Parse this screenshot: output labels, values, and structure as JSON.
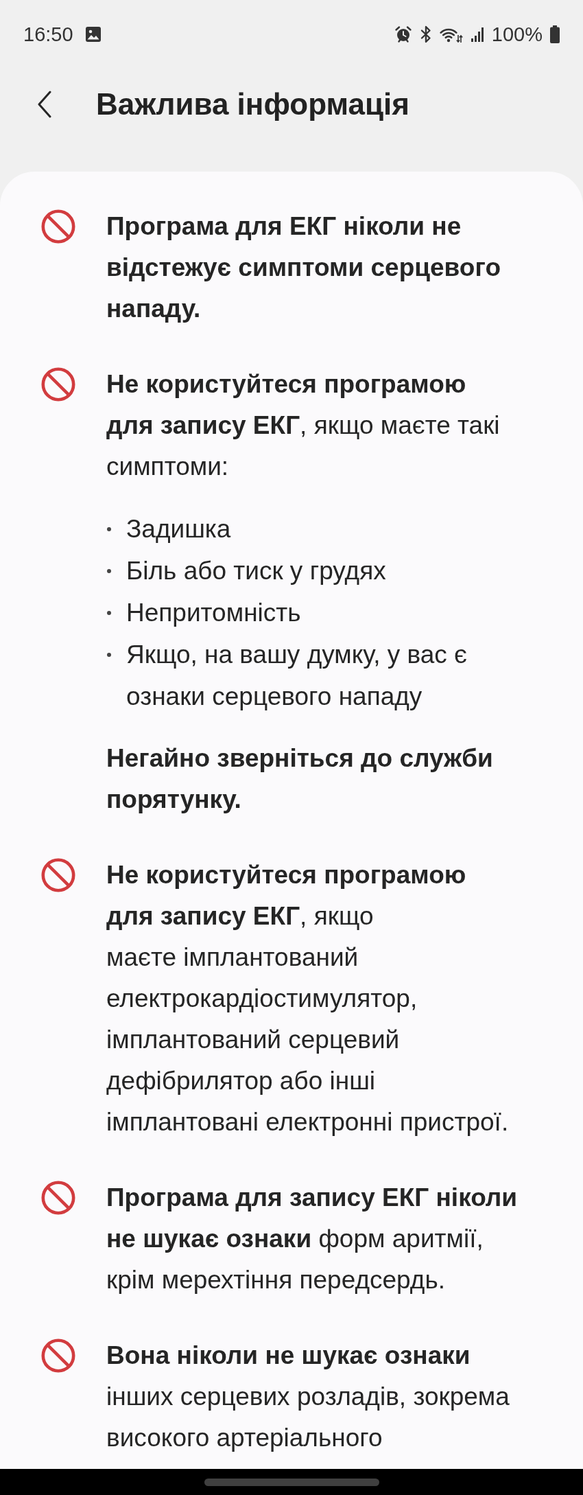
{
  "status_bar": {
    "time": "16:50",
    "battery": "100%"
  },
  "header": {
    "title": "Важлива інформація"
  },
  "warnings": [
    {
      "blocks": [
        {
          "kind": "bold_paragraph",
          "text": "Програма для ЕКГ ніколи не відстежує симптоми серцевого нападу."
        }
      ]
    },
    {
      "blocks": [
        {
          "kind": "paragraph",
          "text": "**Не користуйтеся програмою для запису ЕКГ**, якщо маєте такі симптоми:"
        },
        {
          "kind": "bullets",
          "items": [
            "Задишка",
            "Біль або тиск у грудях",
            "Непритомність",
            "Якщо, на вашу думку, у вас є ознаки серцевого нападу"
          ]
        },
        {
          "kind": "bold_paragraph",
          "text": "Негайно зверніться до служби порятунку."
        }
      ]
    },
    {
      "blocks": [
        {
          "kind": "paragraph",
          "text": "**Не користуйтеся програмою для запису ЕКГ**, якщо маєте імплантований електрокардіостимулятор, імплантований серцевий дефібрилятор або інші імплантовані електронні пристрої."
        }
      ]
    },
    {
      "blocks": [
        {
          "kind": "paragraph",
          "text": "**Програма для запису ЕКГ ніколи не шукає ознаки** форм аритмії, крім мерехтіння передсердь."
        }
      ]
    },
    {
      "blocks": [
        {
          "kind": "paragraph",
          "text": "**Вона ніколи не шукає ознаки** інших серцевих розладів, зокрема високого артеріального"
        }
      ]
    }
  ]
}
